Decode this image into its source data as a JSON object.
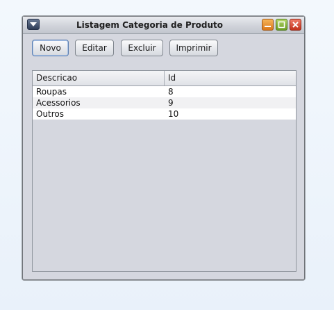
{
  "window": {
    "title": "Listagem Categoria de Produto"
  },
  "icons": {
    "system_menu": "triangle-down-icon",
    "minimize": "minimize-icon",
    "maximize": "maximize-icon",
    "close": "close-icon"
  },
  "colors": {
    "minimize": "#e08a2a",
    "maximize": "#7aaa2e",
    "close": "#d04328",
    "window_bg": "#d5d7df"
  },
  "toolbar": {
    "novo_label": "Novo",
    "editar_label": "Editar",
    "excluir_label": "Excluir",
    "imprimir_label": "Imprimir"
  },
  "table": {
    "columns": [
      "Descricao",
      "Id"
    ],
    "rows": [
      {
        "descricao": "Roupas",
        "id": "8"
      },
      {
        "descricao": "Acessorios",
        "id": "9"
      },
      {
        "descricao": "Outros",
        "id": "10"
      }
    ]
  }
}
